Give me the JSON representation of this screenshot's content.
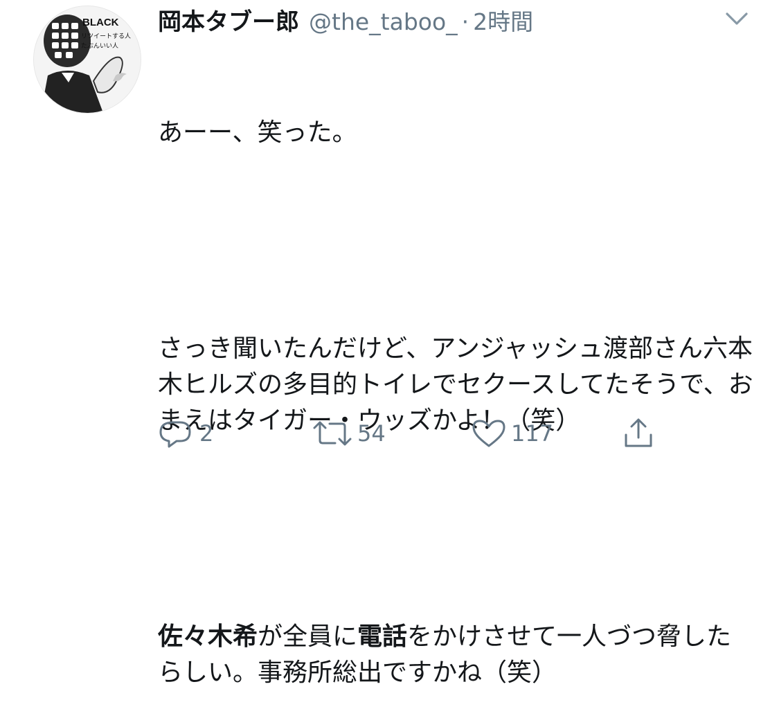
{
  "avatar": {
    "badge_text": "BLACK",
    "caption_line1": "リツイートする人",
    "caption_line2": "たぶんいい人"
  },
  "header": {
    "display_name": "岡本タブー郎",
    "handle": "@the_taboo_",
    "separator": "·",
    "time": "2時間",
    "menu_icon": "chevron-down-icon"
  },
  "tweet": {
    "line1": "あーー、笑った。",
    "line2": "さっき聞いたんだけど、アンジャッシュ渡部さん六本木ヒルズの多目的トイレでセクースしてたそうで、おまえはタイガー・ウッズかよ！（笑）",
    "line3_bold1": "佐々木希",
    "line3_text1": "が全員に",
    "line3_bold2": "電話",
    "line3_text2": "をかけさせて一人づつ脅したらしい。事務所総出ですかね（笑）"
  },
  "actions": {
    "reply": {
      "icon": "reply-icon",
      "count": "2"
    },
    "retweet": {
      "icon": "retweet-icon",
      "count": "54"
    },
    "like": {
      "icon": "heart-icon",
      "count": "117"
    },
    "share": {
      "icon": "share-icon"
    }
  },
  "colors": {
    "text": "#14171a",
    "secondary": "#657786",
    "background": "#ffffff"
  }
}
